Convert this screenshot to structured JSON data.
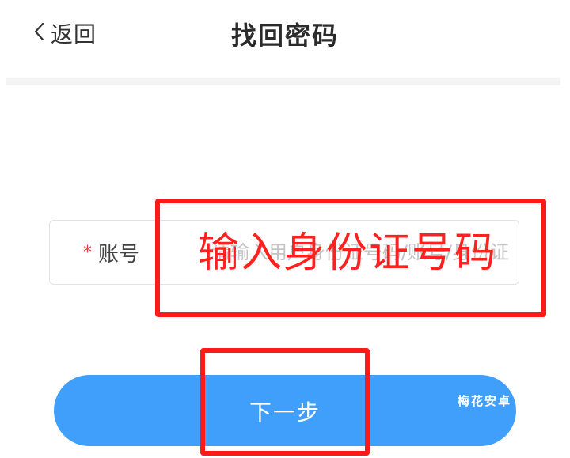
{
  "header": {
    "back_label": "返回",
    "title": "找回密码"
  },
  "form": {
    "account_label": "账号",
    "required_mark": "*",
    "account_placeholder": "请输入用户身份证号码/账号/身份证",
    "account_value": ""
  },
  "annotations": {
    "input_hint": "输入身份证号码",
    "color": "#ff1a1a"
  },
  "actions": {
    "next_label": "下一步"
  },
  "watermark": {
    "text": "梅花安卓"
  },
  "colors": {
    "primary": "#409ffa",
    "required": "#e04040",
    "annotation": "#ff1a1a"
  }
}
